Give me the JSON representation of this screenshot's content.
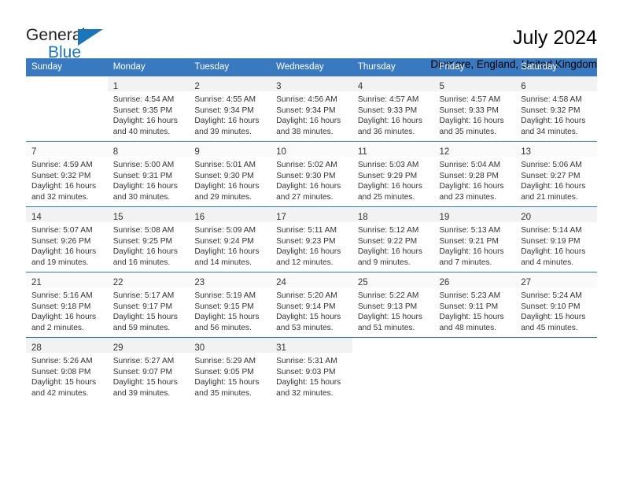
{
  "brand": {
    "name_top": "General",
    "name_bottom": "Blue",
    "accent_color": "#1b75bb"
  },
  "header": {
    "title": "July 2024",
    "subtitle": "Dinmore, England, United Kingdom"
  },
  "calendar": {
    "header_bg": "#3879c0",
    "weekdays": [
      "Sunday",
      "Monday",
      "Tuesday",
      "Wednesday",
      "Thursday",
      "Friday",
      "Saturday"
    ],
    "weeks": [
      [
        {
          "day": "",
          "lines": []
        },
        {
          "day": "1",
          "lines": [
            "Sunrise: 4:54 AM",
            "Sunset: 9:35 PM",
            "Daylight: 16 hours",
            "and 40 minutes."
          ]
        },
        {
          "day": "2",
          "lines": [
            "Sunrise: 4:55 AM",
            "Sunset: 9:34 PM",
            "Daylight: 16 hours",
            "and 39 minutes."
          ]
        },
        {
          "day": "3",
          "lines": [
            "Sunrise: 4:56 AM",
            "Sunset: 9:34 PM",
            "Daylight: 16 hours",
            "and 38 minutes."
          ]
        },
        {
          "day": "4",
          "lines": [
            "Sunrise: 4:57 AM",
            "Sunset: 9:33 PM",
            "Daylight: 16 hours",
            "and 36 minutes."
          ]
        },
        {
          "day": "5",
          "lines": [
            "Sunrise: 4:57 AM",
            "Sunset: 9:33 PM",
            "Daylight: 16 hours",
            "and 35 minutes."
          ]
        },
        {
          "day": "6",
          "lines": [
            "Sunrise: 4:58 AM",
            "Sunset: 9:32 PM",
            "Daylight: 16 hours",
            "and 34 minutes."
          ]
        }
      ],
      [
        {
          "day": "7",
          "lines": [
            "Sunrise: 4:59 AM",
            "Sunset: 9:32 PM",
            "Daylight: 16 hours",
            "and 32 minutes."
          ]
        },
        {
          "day": "8",
          "lines": [
            "Sunrise: 5:00 AM",
            "Sunset: 9:31 PM",
            "Daylight: 16 hours",
            "and 30 minutes."
          ]
        },
        {
          "day": "9",
          "lines": [
            "Sunrise: 5:01 AM",
            "Sunset: 9:30 PM",
            "Daylight: 16 hours",
            "and 29 minutes."
          ]
        },
        {
          "day": "10",
          "lines": [
            "Sunrise: 5:02 AM",
            "Sunset: 9:30 PM",
            "Daylight: 16 hours",
            "and 27 minutes."
          ]
        },
        {
          "day": "11",
          "lines": [
            "Sunrise: 5:03 AM",
            "Sunset: 9:29 PM",
            "Daylight: 16 hours",
            "and 25 minutes."
          ]
        },
        {
          "day": "12",
          "lines": [
            "Sunrise: 5:04 AM",
            "Sunset: 9:28 PM",
            "Daylight: 16 hours",
            "and 23 minutes."
          ]
        },
        {
          "day": "13",
          "lines": [
            "Sunrise: 5:06 AM",
            "Sunset: 9:27 PM",
            "Daylight: 16 hours",
            "and 21 minutes."
          ]
        }
      ],
      [
        {
          "day": "14",
          "lines": [
            "Sunrise: 5:07 AM",
            "Sunset: 9:26 PM",
            "Daylight: 16 hours",
            "and 19 minutes."
          ]
        },
        {
          "day": "15",
          "lines": [
            "Sunrise: 5:08 AM",
            "Sunset: 9:25 PM",
            "Daylight: 16 hours",
            "and 16 minutes."
          ]
        },
        {
          "day": "16",
          "lines": [
            "Sunrise: 5:09 AM",
            "Sunset: 9:24 PM",
            "Daylight: 16 hours",
            "and 14 minutes."
          ]
        },
        {
          "day": "17",
          "lines": [
            "Sunrise: 5:11 AM",
            "Sunset: 9:23 PM",
            "Daylight: 16 hours",
            "and 12 minutes."
          ]
        },
        {
          "day": "18",
          "lines": [
            "Sunrise: 5:12 AM",
            "Sunset: 9:22 PM",
            "Daylight: 16 hours",
            "and 9 minutes."
          ]
        },
        {
          "day": "19",
          "lines": [
            "Sunrise: 5:13 AM",
            "Sunset: 9:21 PM",
            "Daylight: 16 hours",
            "and 7 minutes."
          ]
        },
        {
          "day": "20",
          "lines": [
            "Sunrise: 5:14 AM",
            "Sunset: 9:19 PM",
            "Daylight: 16 hours",
            "and 4 minutes."
          ]
        }
      ],
      [
        {
          "day": "21",
          "lines": [
            "Sunrise: 5:16 AM",
            "Sunset: 9:18 PM",
            "Daylight: 16 hours",
            "and 2 minutes."
          ]
        },
        {
          "day": "22",
          "lines": [
            "Sunrise: 5:17 AM",
            "Sunset: 9:17 PM",
            "Daylight: 15 hours",
            "and 59 minutes."
          ]
        },
        {
          "day": "23",
          "lines": [
            "Sunrise: 5:19 AM",
            "Sunset: 9:15 PM",
            "Daylight: 15 hours",
            "and 56 minutes."
          ]
        },
        {
          "day": "24",
          "lines": [
            "Sunrise: 5:20 AM",
            "Sunset: 9:14 PM",
            "Daylight: 15 hours",
            "and 53 minutes."
          ]
        },
        {
          "day": "25",
          "lines": [
            "Sunrise: 5:22 AM",
            "Sunset: 9:13 PM",
            "Daylight: 15 hours",
            "and 51 minutes."
          ]
        },
        {
          "day": "26",
          "lines": [
            "Sunrise: 5:23 AM",
            "Sunset: 9:11 PM",
            "Daylight: 15 hours",
            "and 48 minutes."
          ]
        },
        {
          "day": "27",
          "lines": [
            "Sunrise: 5:24 AM",
            "Sunset: 9:10 PM",
            "Daylight: 15 hours",
            "and 45 minutes."
          ]
        }
      ],
      [
        {
          "day": "28",
          "lines": [
            "Sunrise: 5:26 AM",
            "Sunset: 9:08 PM",
            "Daylight: 15 hours",
            "and 42 minutes."
          ]
        },
        {
          "day": "29",
          "lines": [
            "Sunrise: 5:27 AM",
            "Sunset: 9:07 PM",
            "Daylight: 15 hours",
            "and 39 minutes."
          ]
        },
        {
          "day": "30",
          "lines": [
            "Sunrise: 5:29 AM",
            "Sunset: 9:05 PM",
            "Daylight: 15 hours",
            "and 35 minutes."
          ]
        },
        {
          "day": "31",
          "lines": [
            "Sunrise: 5:31 AM",
            "Sunset: 9:03 PM",
            "Daylight: 15 hours",
            "and 32 minutes."
          ]
        },
        {
          "day": "",
          "lines": []
        },
        {
          "day": "",
          "lines": []
        },
        {
          "day": "",
          "lines": []
        }
      ]
    ]
  }
}
